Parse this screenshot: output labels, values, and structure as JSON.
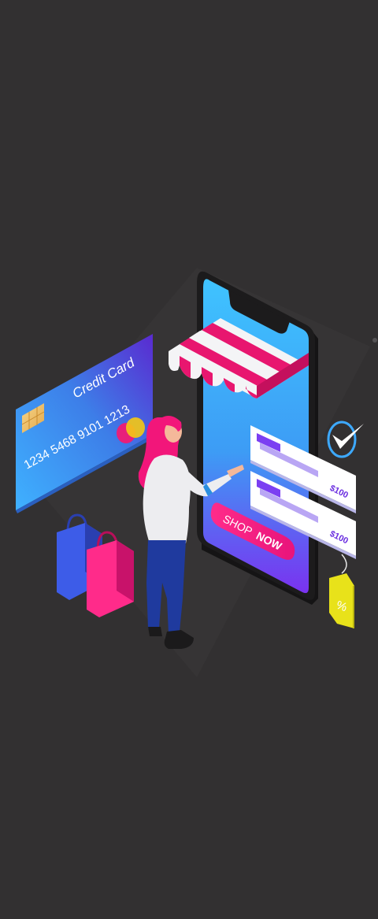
{
  "illustration": {
    "credit_card": {
      "title": "Credit Card",
      "number": "1234 5468 9101 1213"
    },
    "phone": {
      "button_label_light": "SHOP",
      "button_label_bold": "NOW"
    },
    "products": [
      {
        "price": "$100"
      },
      {
        "price": "$100"
      }
    ],
    "tag": {
      "symbol": "%"
    }
  },
  "colors": {
    "background": "#323031",
    "accent_pink": "#ff2f86",
    "accent_purple": "#7b3ff2",
    "phone_blue": "#2fb6ff",
    "tag_yellow": "#e8e21a",
    "bag_blue": "#3d5ce8"
  }
}
